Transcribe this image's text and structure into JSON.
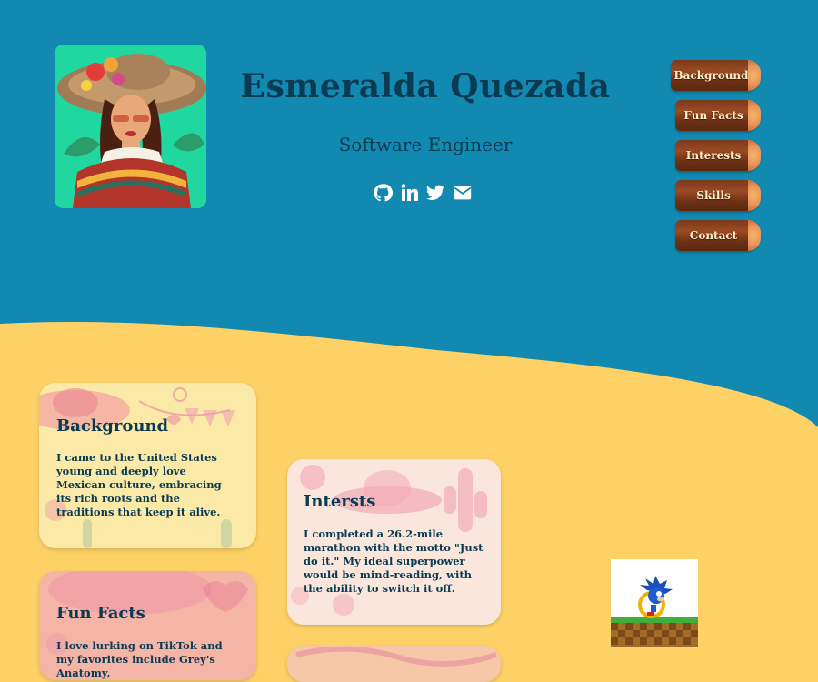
{
  "profile": {
    "name": "Esmeralda Quezada",
    "title": "Software Engineer",
    "avatar_icon": "portrait-avatar-icon"
  },
  "socials": [
    {
      "icon": "github-icon"
    },
    {
      "icon": "linkedin-icon"
    },
    {
      "icon": "twitter-icon"
    },
    {
      "icon": "email-icon"
    }
  ],
  "nav": {
    "items": [
      {
        "label": "Background"
      },
      {
        "label": "Fun Facts"
      },
      {
        "label": "Interests"
      },
      {
        "label": "Skills"
      },
      {
        "label": "Contact"
      }
    ]
  },
  "cards": {
    "background": {
      "title": "Background",
      "text": "I came to the United States young and deeply love Mexican culture, embracing its rich roots and the traditions that keep it alive."
    },
    "interests": {
      "title": "Intersts",
      "text": "I completed a 26.2-mile marathon with the motto \"Just do it.\" My ideal superpower would be mind-reading, with the ability to switch it off."
    },
    "fun_facts": {
      "title": "Fun Facts",
      "text": "I love lurking on TikTok and my favorites include Grey's Anatomy,"
    }
  },
  "colors": {
    "header_bg": "#1289b0",
    "body_bg": "#fdd166",
    "heading": "#0b3b52",
    "avatar_bg": "#21d7a0"
  }
}
